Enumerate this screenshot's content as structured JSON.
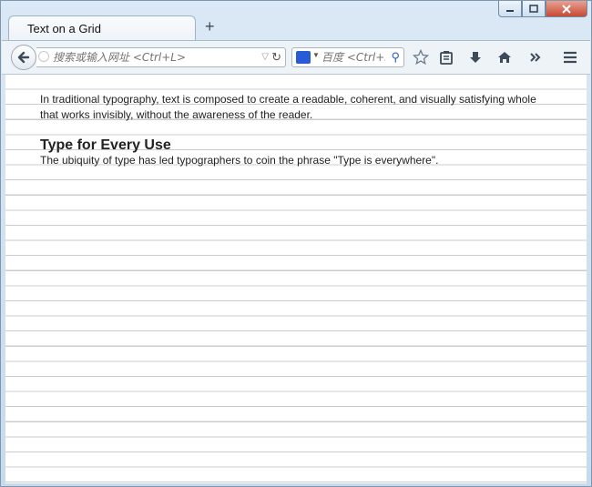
{
  "browser": {
    "tab_title": "Text on a Grid",
    "new_tab_label": "+",
    "url_placeholder": "搜索或输入网址 <Ctrl+L>",
    "search_placeholder": "百度 <Ctrl+K",
    "icons": {
      "back": "back-arrow-icon",
      "reload": "reload-icon",
      "search_engine": "baidu-logo-icon",
      "bookmark": "star-icon",
      "reading_list": "clipboard-icon",
      "downloads": "download-arrow-icon",
      "home": "home-icon",
      "overflow": "chevron-double-right-icon",
      "menu": "hamburger-menu-icon"
    },
    "colors": {
      "frame": "#c6daee",
      "close_button": "#c64a34",
      "grid_line": "#c9ccd1"
    }
  },
  "page": {
    "intro_paragraph": "In traditional typography, text is composed to create a readable, coherent, and visually satisfying whole that works invisibly, without the awareness of the reader.",
    "heading": "Type for Every Use",
    "body_paragraph": "The ubiquity of type has led typographers to coin the phrase \"Type is everywhere\"."
  }
}
